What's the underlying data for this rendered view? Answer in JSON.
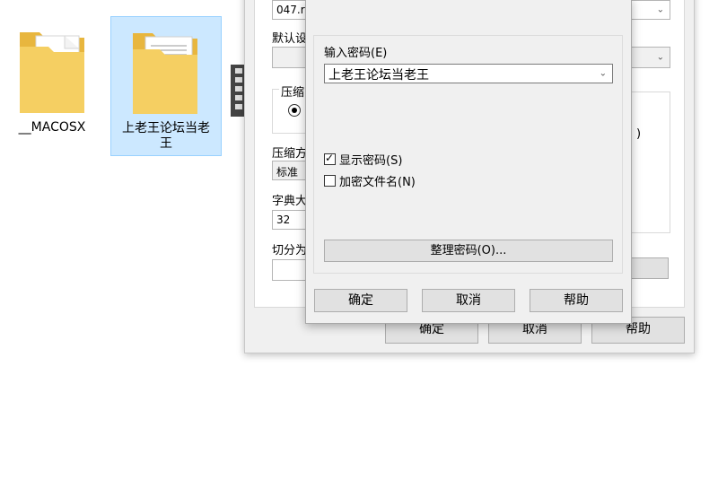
{
  "explorer": {
    "items": [
      {
        "name": "__MACOSX",
        "selected": false
      },
      {
        "name_line1": "上老王论坛当老",
        "name_line2": "王",
        "selected": true
      }
    ]
  },
  "archive_dialog": {
    "archive_name_value": "047.r",
    "default_label": "默认设",
    "compress_group_label": "压缩",
    "compress_method_label": "压缩方",
    "compress_method_value": "标准",
    "dict_label": "字典大",
    "dict_value": "32",
    "split_label": "切分为",
    "ok": "确定",
    "cancel": "取消",
    "help": "帮助"
  },
  "password_dialog": {
    "enter_password_label": "输入密码(E)",
    "password_value": "上老王论坛当老王",
    "show_password_label": "显示密码(S)",
    "show_password_checked": true,
    "encrypt_names_label": "加密文件名(N)",
    "encrypt_names_checked": false,
    "organize_button": "整理密码(O)...",
    "ok": "确定",
    "cancel": "取消",
    "help": "帮助"
  }
}
